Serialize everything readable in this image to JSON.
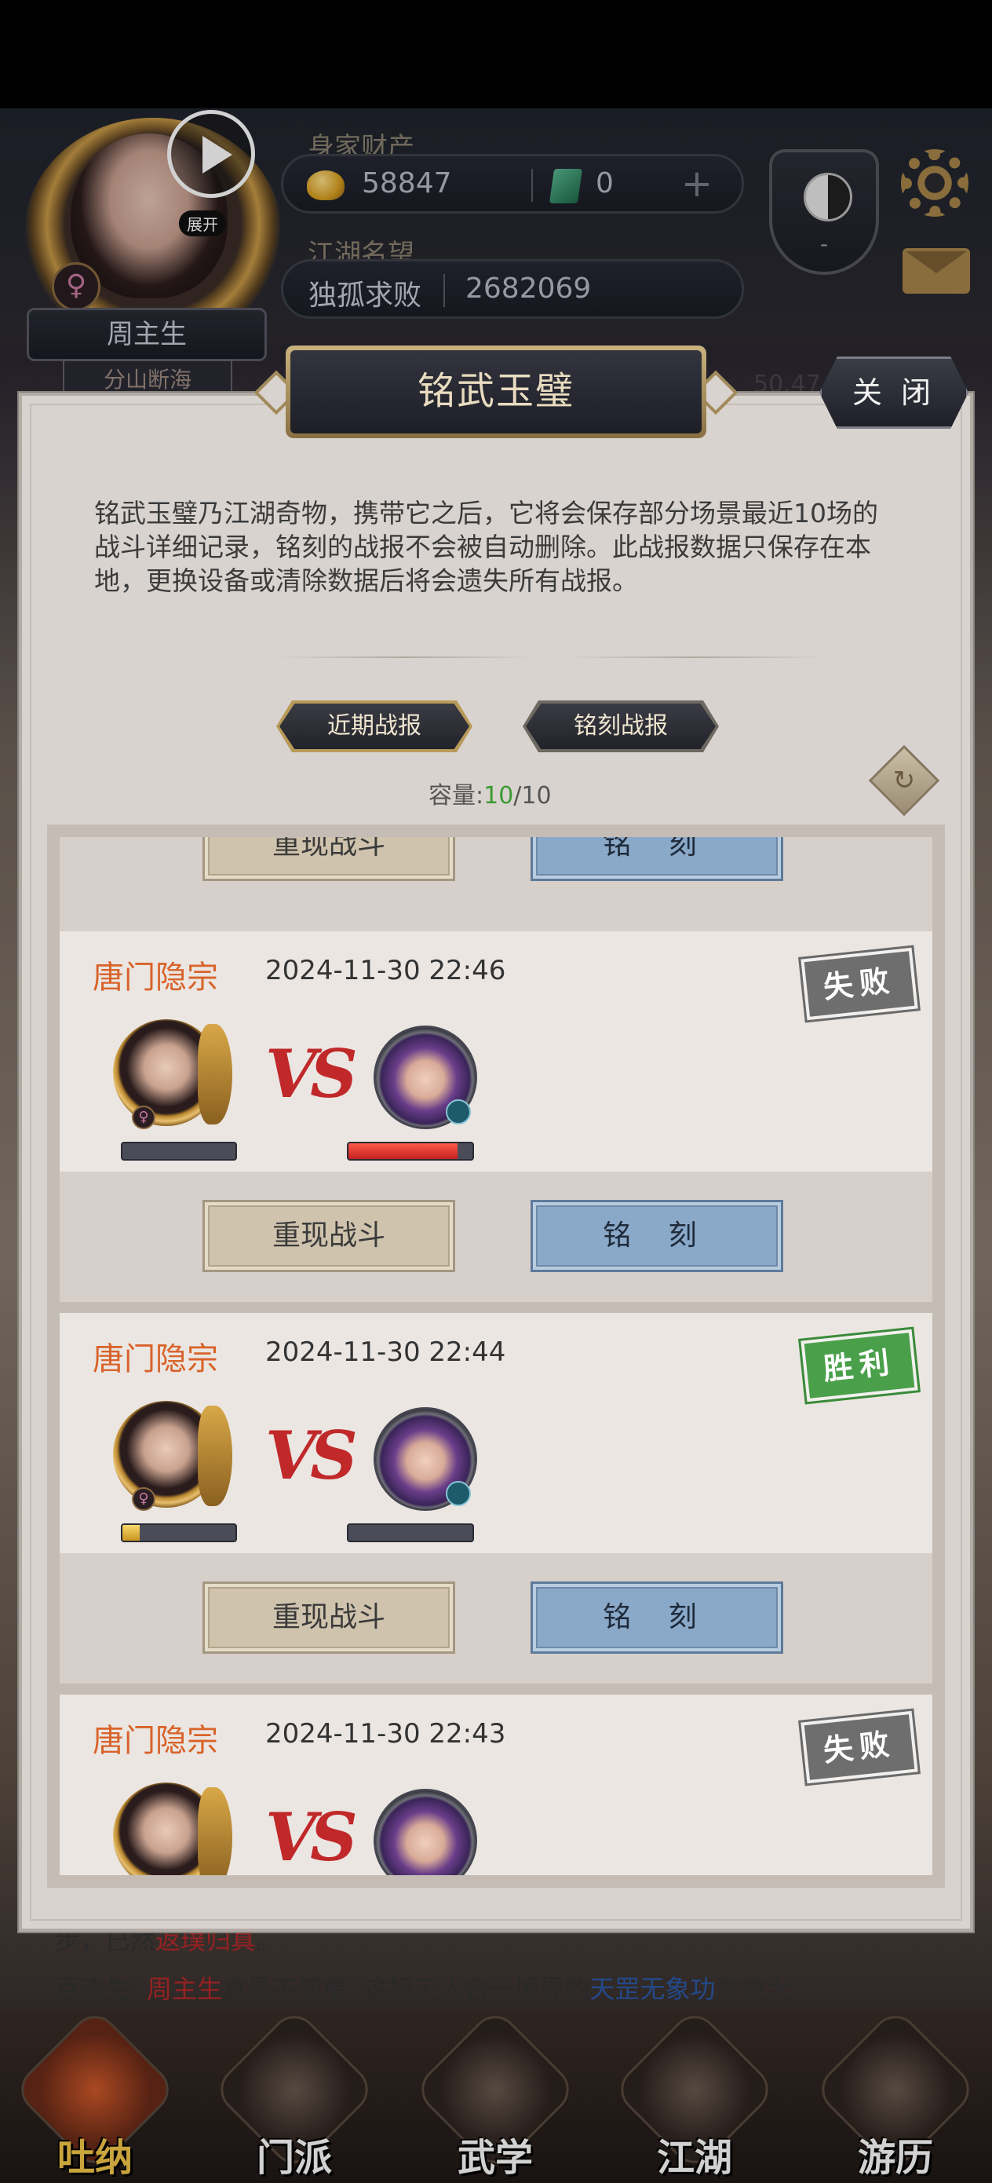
{
  "hud": {
    "player_name": "周主生",
    "player_subtitle": "分山断海",
    "gender_symbol": "♀",
    "expand_label": "展开",
    "wealth_label": "身家财产",
    "gold_value": "58847",
    "jade_value": "0",
    "fame_label": "江湖名望",
    "fame_title": "独孤求败",
    "fame_value": "2682069",
    "taiji_value": "-",
    "bg_number": "50.47"
  },
  "modal": {
    "title": "铭武玉璧",
    "close_label": "关 闭",
    "description": "铭武玉璧乃江湖奇物，携带它之后，它将会保存部分场景最近10场的战斗详细记录，铭刻的战报不会被自动删除。此战报数据只保存在本地，更换设备或清除数据后将会遗失所有战报。",
    "tabs": [
      {
        "label": "近期战报",
        "selected": true
      },
      {
        "label": "铭刻战报",
        "selected": false
      }
    ],
    "capacity_label": "容量:",
    "capacity_used": "10",
    "capacity_total": "/10",
    "replay_label": "重现战斗",
    "engrave_label": "铭 刻"
  },
  "battles": [
    {
      "sect": "唐门隐宗",
      "time": "2024-11-30 22:46",
      "result": "失败",
      "result_color": "#6e6e6e",
      "left_hp": 0.0,
      "right_hp": 0.88
    },
    {
      "sect": "唐门隐宗",
      "time": "2024-11-30 22:44",
      "result": "胜利",
      "result_color": "#4aa04a",
      "left_hp": 0.15,
      "right_hp": 0.0
    },
    {
      "sect": "唐门隐宗",
      "time": "2024-11-30 22:43",
      "result": "失败",
      "result_color": "#6e6e6e",
      "left_hp": 0.0,
      "right_hp": 0.88
    }
  ],
  "vs_label": "VS",
  "log": {
    "line1_prefix": "步，已然",
    "line1_highlight": "返璞归真",
    "line1_suffix": "。",
    "line2_speaker": "百晓生: ",
    "line2_name": "周主生",
    "line2_mid": "真是不简单, 这招天人合一境界的",
    "line2_skill": "天罡无象功",
    "line2_end": "竟被大"
  },
  "nav": [
    {
      "label": "吐纳",
      "active": true
    },
    {
      "label": "门派",
      "active": false
    },
    {
      "label": "武学",
      "active": false
    },
    {
      "label": "江湖",
      "active": false
    },
    {
      "label": "游历",
      "active": false
    }
  ]
}
